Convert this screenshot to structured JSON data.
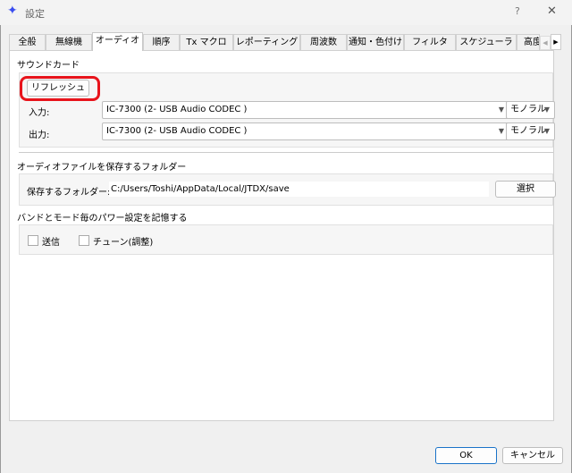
{
  "window": {
    "title": "設定",
    "help": "?",
    "close": "✕",
    "icon": "star-icon"
  },
  "tabs": [
    "全般",
    "無線機",
    "オーディオ",
    "順序",
    "Tx マクロ",
    "レポーティング",
    "周波数",
    "通知・色付け",
    "フィルタ",
    "スケジューラ",
    "高度"
  ],
  "active_tab": "オーディオ",
  "soundcard": {
    "title": "サウンドカード",
    "refresh": "リフレッシュ",
    "input_label": "入力:",
    "input_value": "IC-7300 (2- USB Audio CODEC )",
    "input_channel": "モノラル",
    "output_label": "出力:",
    "output_value": "IC-7300 (2- USB Audio CODEC )",
    "output_channel": "モノラル"
  },
  "folder": {
    "title": "オーディオファイルを保存するフォルダー",
    "label": "保存するフォルダー:",
    "path": "C:/Users/Toshi/AppData/Local/JTDX/save",
    "select": "選択"
  },
  "power": {
    "title": "バンドとモード毎のパワー設定を記憶する",
    "transmit": "送信",
    "tune": "チューン(調整)"
  },
  "footer": {
    "ok": "OK",
    "cancel": "キャンセル"
  },
  "colors": {
    "highlight": "#e8141c",
    "icon": "#3a4df0"
  }
}
